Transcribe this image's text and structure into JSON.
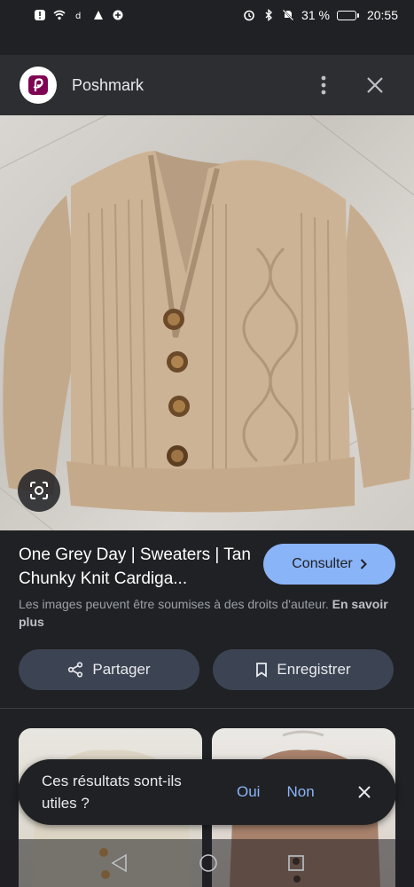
{
  "status_bar": {
    "time": "20:55",
    "battery_percent": "31 %",
    "icons": [
      "alert-icon",
      "wifi-icon",
      "d-icon",
      "app-icon",
      "vpn-icon",
      "alarm-icon",
      "bluetooth-icon",
      "mute-icon",
      "battery-icon"
    ]
  },
  "header": {
    "site_name": "Poshmark",
    "logo_icon": "poshmark-logo",
    "more_icon": "more-vert-icon",
    "close_icon": "close-icon"
  },
  "image": {
    "lens_icon": "lens-icon"
  },
  "product": {
    "title": "One Grey Day | Sweaters | Tan Chunky Knit Cardiga...",
    "visit_label": "Consulter",
    "disclaimer": "Les images peuvent être soumises à des droits d'auteur.",
    "learn_more": "En savoir plus"
  },
  "actions": {
    "share_label": "Partager",
    "save_label": "Enregistrer"
  },
  "feedback": {
    "question": "Ces résultats sont-ils utiles ?",
    "yes_label": "Oui",
    "no_label": "Non"
  },
  "colors": {
    "background": "#202124",
    "accent": "#8ab4f8",
    "brand": "#7f0353",
    "button_bg": "#3c4453"
  }
}
